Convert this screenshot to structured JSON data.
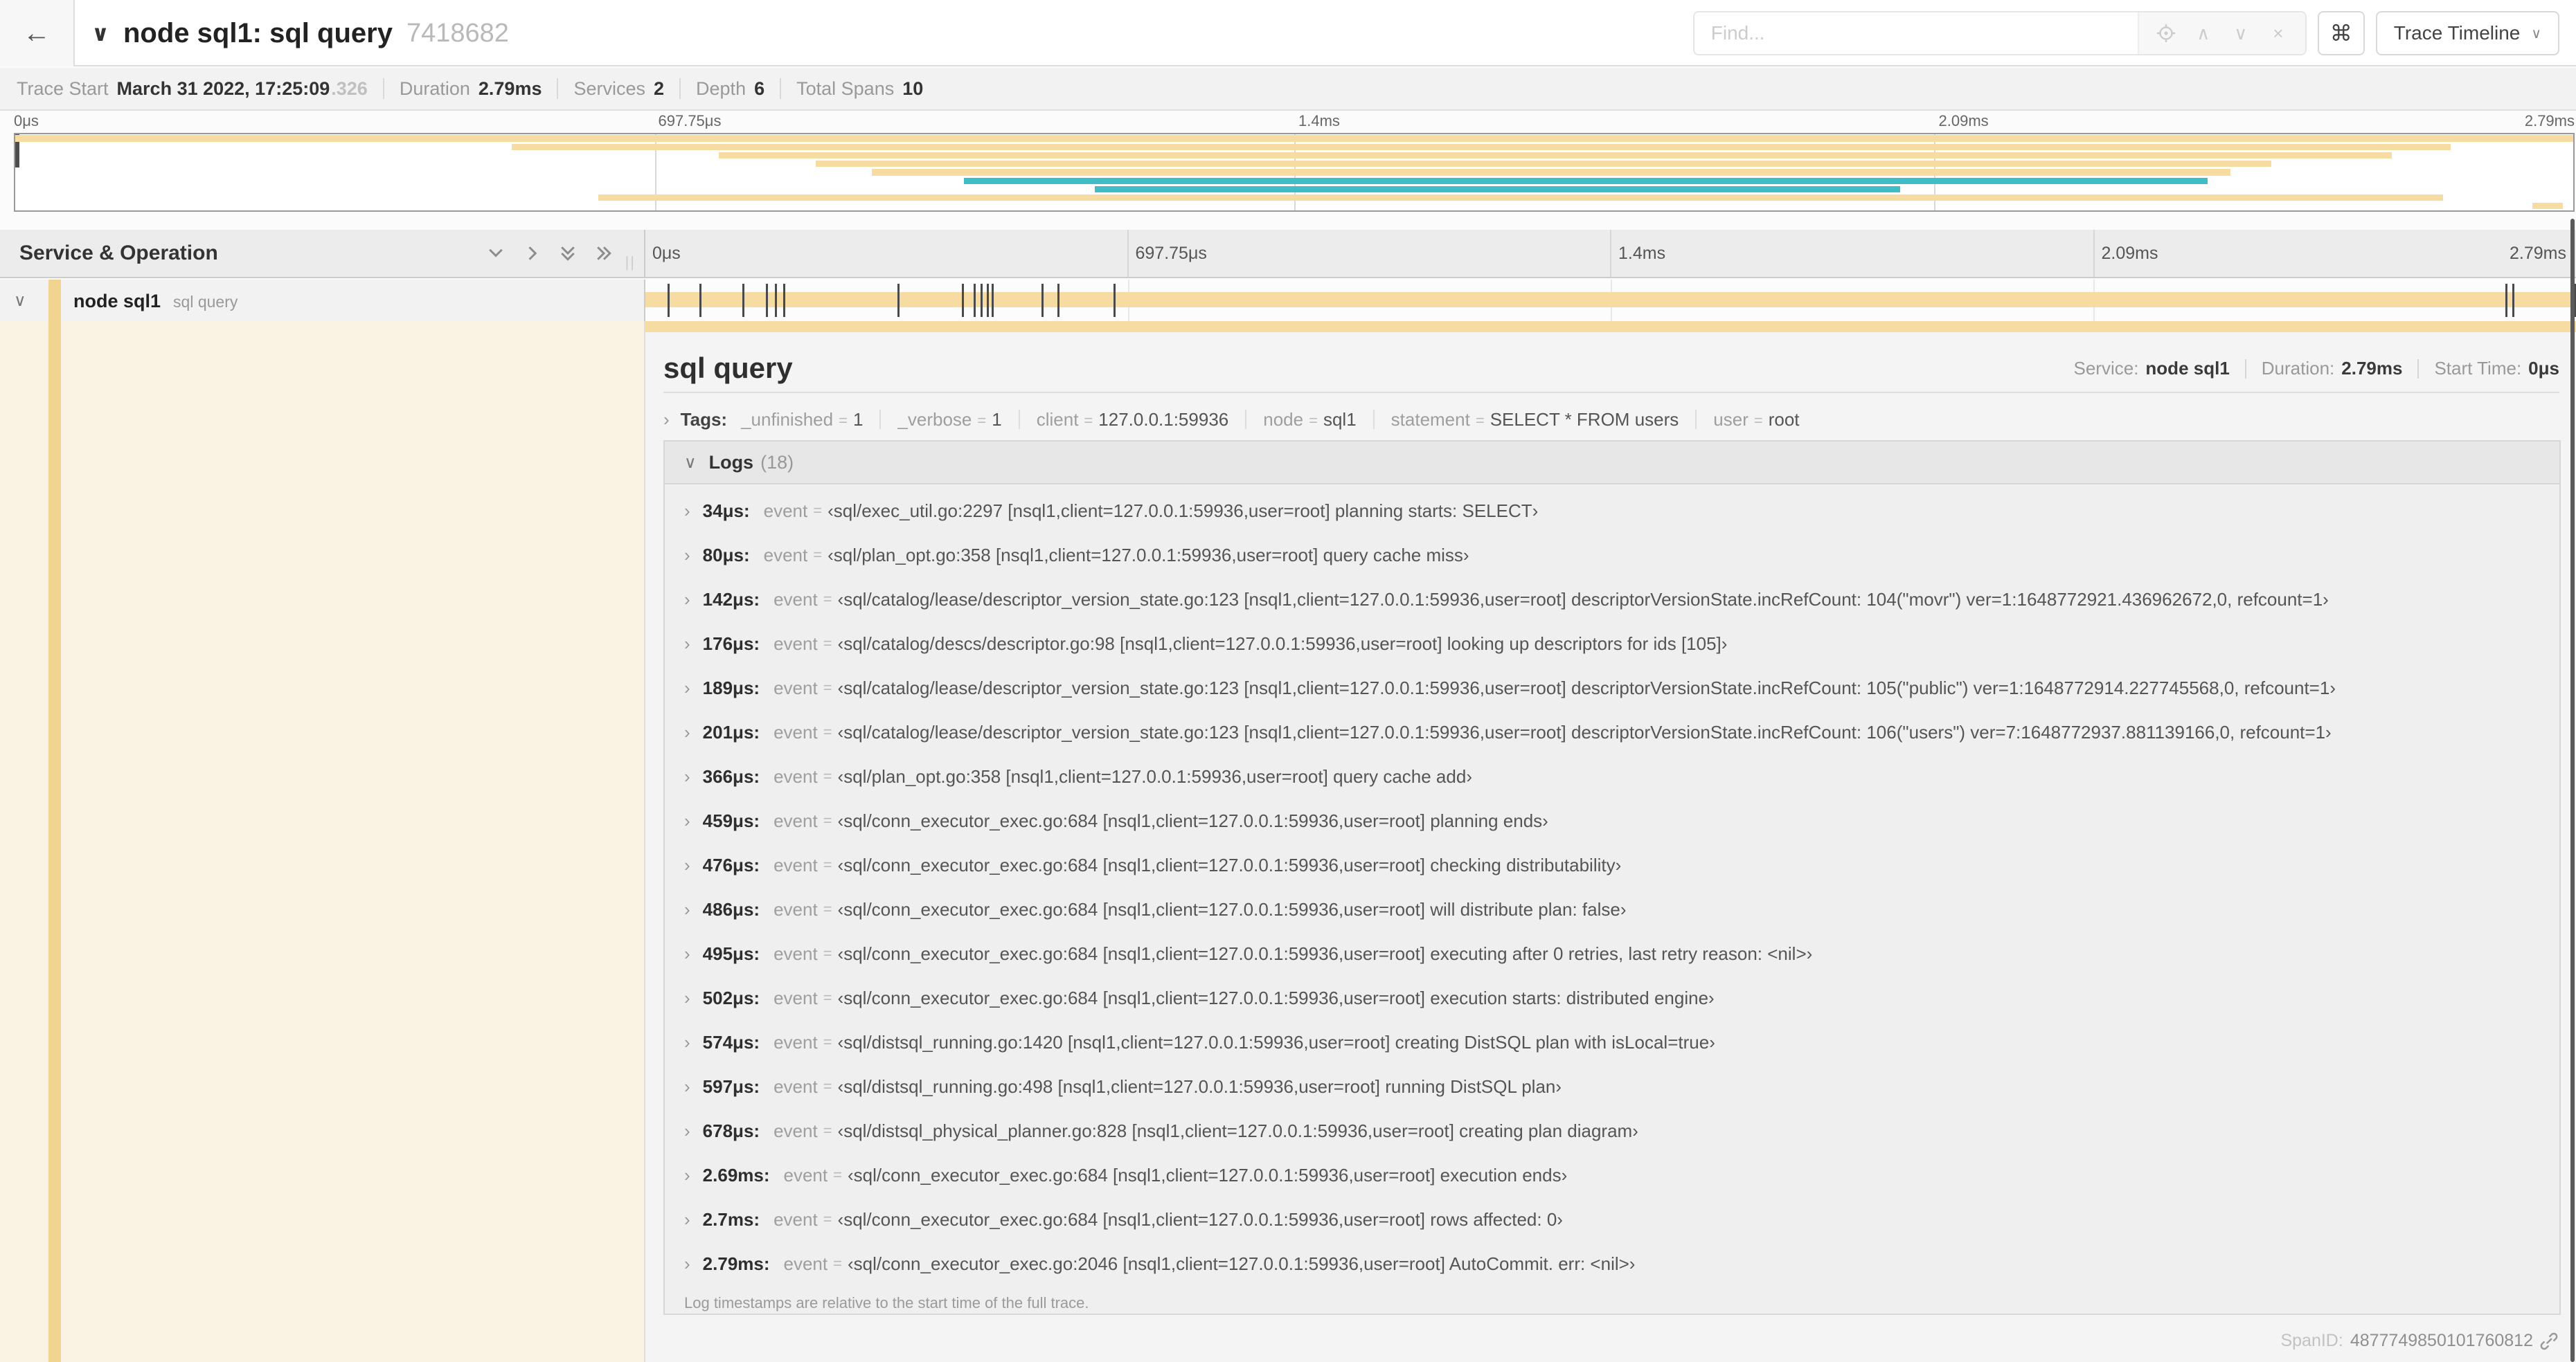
{
  "icons": {
    "back": "←",
    "chevron_down": "∨",
    "chevron_right": "›",
    "chevron_up": "∧",
    "close": "×",
    "command": "⌘",
    "grip": "||"
  },
  "header": {
    "title": "node sql1: sql query",
    "trace_id_suffix": "7418682",
    "find_placeholder": "Find...",
    "view_selector_label": "Trace Timeline"
  },
  "summary": {
    "items": [
      {
        "label": "Trace Start",
        "value": "March 31 2022, 17:25:09",
        "value_suffix": ".326"
      },
      {
        "label": "Duration",
        "value": "2.79ms"
      },
      {
        "label": "Services",
        "value": "2"
      },
      {
        "label": "Depth",
        "value": "6"
      },
      {
        "label": "Total Spans",
        "value": "10"
      }
    ]
  },
  "minimap": {
    "ticks": [
      "0μs",
      "697.75μs",
      "1.4ms",
      "2.09ms",
      "2.79ms"
    ],
    "colors": {
      "tan": "#f6dba2",
      "teal": "#3fbdc6"
    },
    "rows": [
      {
        "start_pct": 0,
        "end_pct": 100,
        "color": "tan"
      },
      {
        "start_pct": 19.4,
        "end_pct": 95.2,
        "color": "tan"
      },
      {
        "start_pct": 27.5,
        "end_pct": 92.9,
        "color": "tan"
      },
      {
        "start_pct": 31.3,
        "end_pct": 88.2,
        "color": "tan"
      },
      {
        "start_pct": 33.5,
        "end_pct": 86.6,
        "color": "tan"
      },
      {
        "start_pct": 37.1,
        "end_pct": 85.7,
        "color": "teal"
      },
      {
        "start_pct": 42.2,
        "end_pct": 73.7,
        "color": "teal"
      },
      {
        "start_pct": 22.8,
        "end_pct": 94.9,
        "color": "tan"
      },
      {
        "start_pct": 98.4,
        "end_pct": 99.6,
        "color": "tan"
      }
    ]
  },
  "timeline": {
    "header_label": "Service & Operation",
    "ticks": [
      "0μs",
      "697.75μs",
      "1.4ms",
      "2.09ms",
      "2.79ms"
    ],
    "total_us": 2790,
    "span_row": {
      "service": "node sql1",
      "operation": "sql query"
    }
  },
  "detail": {
    "title": "sql query",
    "meta": [
      {
        "label": "Service:",
        "value": "node sql1"
      },
      {
        "label": "Duration:",
        "value": "2.79ms"
      },
      {
        "label": "Start Time:",
        "value": "0μs"
      }
    ],
    "tags": {
      "label": "Tags:",
      "items": [
        {
          "key": "_unfinished",
          "value": "1"
        },
        {
          "key": "_verbose",
          "value": "1"
        },
        {
          "key": "client",
          "value": "127.0.0.1:59936"
        },
        {
          "key": "node",
          "value": "sql1"
        },
        {
          "key": "statement",
          "value": "SELECT * FROM users"
        },
        {
          "key": "user",
          "value": "root"
        }
      ]
    },
    "logs": {
      "label": "Logs",
      "count": "(18)",
      "field_key": "event",
      "entries": [
        {
          "time": "34μs:",
          "t_us": 34,
          "value": "‹sql/exec_util.go:2297 [nsql1,client=127.0.0.1:59936,user=root] planning starts: SELECT›"
        },
        {
          "time": "80μs:",
          "t_us": 80,
          "value": "‹sql/plan_opt.go:358 [nsql1,client=127.0.0.1:59936,user=root] query cache miss›"
        },
        {
          "time": "142μs:",
          "t_us": 142,
          "value": "‹sql/catalog/lease/descriptor_version_state.go:123 [nsql1,client=127.0.0.1:59936,user=root] descriptorVersionState.incRefCount: 104(\"movr\") ver=1:1648772921.436962672,0, refcount=1›"
        },
        {
          "time": "176μs:",
          "t_us": 176,
          "value": "‹sql/catalog/descs/descriptor.go:98 [nsql1,client=127.0.0.1:59936,user=root] looking up descriptors for ids [105]›"
        },
        {
          "time": "189μs:",
          "t_us": 189,
          "value": "‹sql/catalog/lease/descriptor_version_state.go:123 [nsql1,client=127.0.0.1:59936,user=root] descriptorVersionState.incRefCount: 105(\"public\") ver=1:1648772914.227745568,0, refcount=1›"
        },
        {
          "time": "201μs:",
          "t_us": 201,
          "value": "‹sql/catalog/lease/descriptor_version_state.go:123 [nsql1,client=127.0.0.1:59936,user=root] descriptorVersionState.incRefCount: 106(\"users\") ver=7:1648772937.881139166,0, refcount=1›"
        },
        {
          "time": "366μs:",
          "t_us": 366,
          "value": "‹sql/plan_opt.go:358 [nsql1,client=127.0.0.1:59936,user=root] query cache add›"
        },
        {
          "time": "459μs:",
          "t_us": 459,
          "value": "‹sql/conn_executor_exec.go:684 [nsql1,client=127.0.0.1:59936,user=root] planning ends›"
        },
        {
          "time": "476μs:",
          "t_us": 476,
          "value": "‹sql/conn_executor_exec.go:684 [nsql1,client=127.0.0.1:59936,user=root] checking distributability›"
        },
        {
          "time": "486μs:",
          "t_us": 486,
          "value": "‹sql/conn_executor_exec.go:684 [nsql1,client=127.0.0.1:59936,user=root] will distribute plan: false›"
        },
        {
          "time": "495μs:",
          "t_us": 495,
          "value": "‹sql/conn_executor_exec.go:684 [nsql1,client=127.0.0.1:59936,user=root] executing after 0 retries, last retry reason: <nil>›"
        },
        {
          "time": "502μs:",
          "t_us": 502,
          "value": "‹sql/conn_executor_exec.go:684 [nsql1,client=127.0.0.1:59936,user=root] execution starts: distributed engine›"
        },
        {
          "time": "574μs:",
          "t_us": 574,
          "value": "‹sql/distsql_running.go:1420 [nsql1,client=127.0.0.1:59936,user=root] creating DistSQL plan with isLocal=true›"
        },
        {
          "time": "597μs:",
          "t_us": 597,
          "value": "‹sql/distsql_running.go:498 [nsql1,client=127.0.0.1:59936,user=root] running DistSQL plan›"
        },
        {
          "time": "678μs:",
          "t_us": 678,
          "value": "‹sql/distsql_physical_planner.go:828 [nsql1,client=127.0.0.1:59936,user=root] creating plan diagram›"
        },
        {
          "time": "2.69ms:",
          "t_us": 2690,
          "value": "‹sql/conn_executor_exec.go:684 [nsql1,client=127.0.0.1:59936,user=root] execution ends›"
        },
        {
          "time": "2.7ms:",
          "t_us": 2700,
          "value": "‹sql/conn_executor_exec.go:684 [nsql1,client=127.0.0.1:59936,user=root] rows affected: 0›"
        },
        {
          "time": "2.79ms:",
          "t_us": 2790,
          "value": "‹sql/conn_executor_exec.go:2046 [nsql1,client=127.0.0.1:59936,user=root] AutoCommit. err: <nil>›"
        }
      ],
      "footnote": "Log timestamps are relative to the start time of the full trace."
    },
    "span_id_label": "SpanID:",
    "span_id": "4877749850101760812"
  }
}
